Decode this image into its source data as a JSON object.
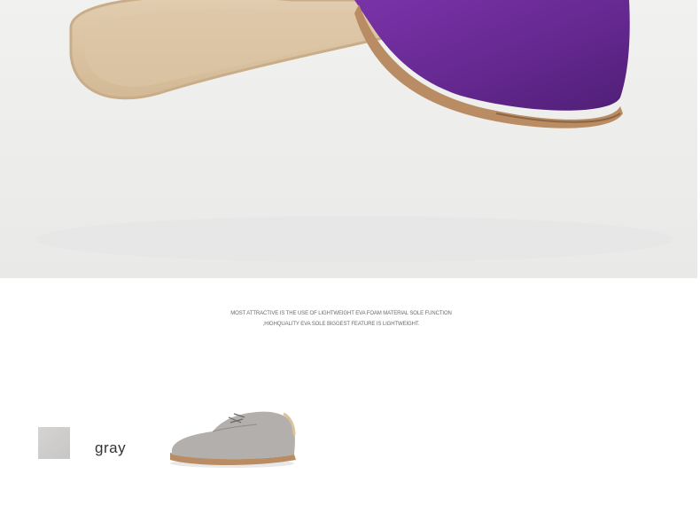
{
  "banner": {
    "caption_line1": "MOST ATTRACTIVE IS THE USE OF LIGHTWEIGHT EVA FOAM MATERIAL SOLE FUNCTION",
    "caption_line2": ",HIGHQUALITY EVA SOLE BIGGEST FEATURE IS LIGHTWEIGHT."
  },
  "color_option": {
    "label": "gray",
    "swatch_color": "#cfcdcb"
  },
  "colors": {
    "shoe_upper": "#6a2a94",
    "sole": "#d9c2a3",
    "gray_shoe": "#a9a6a3"
  }
}
